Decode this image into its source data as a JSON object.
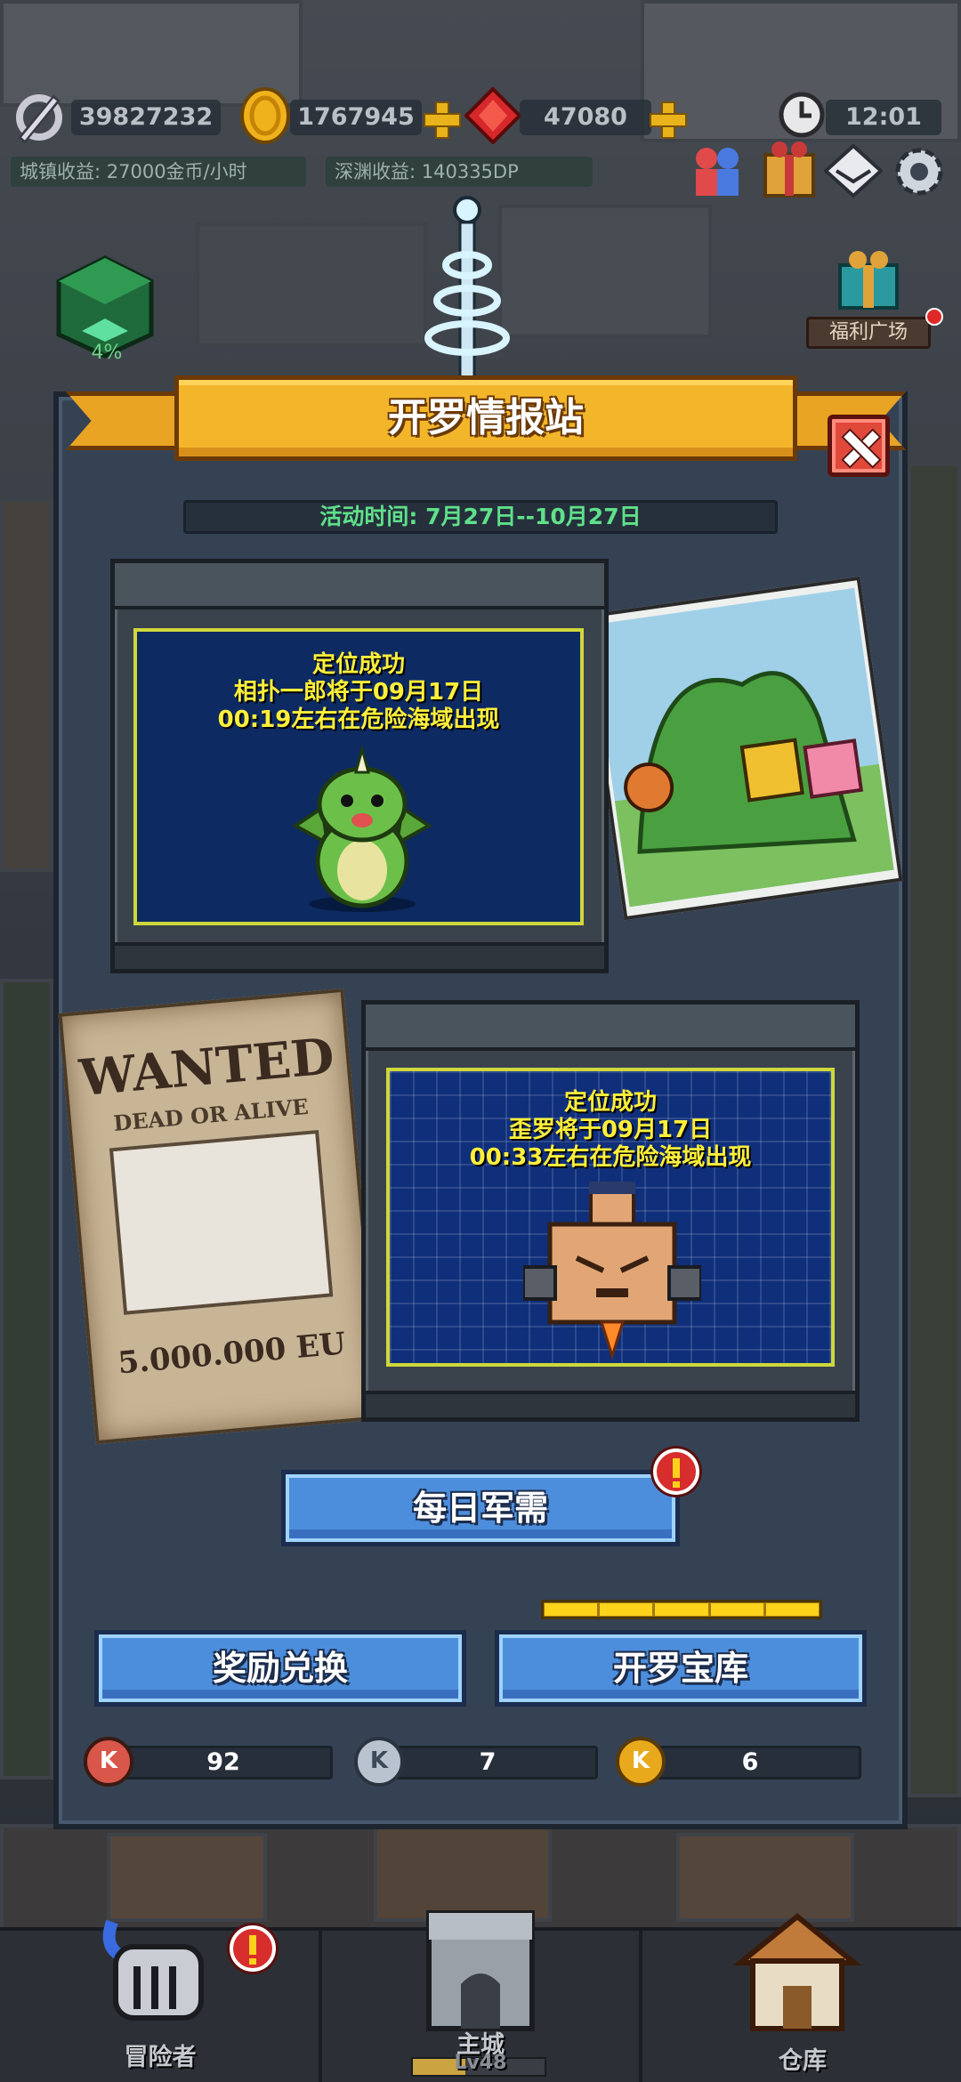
{
  "hud": {
    "power": "39827232",
    "gold": "1767945",
    "gems": "47080",
    "clock": "12:01",
    "town_income": "城镇收益: 27000金币/小时",
    "abyss_income": "深渊收益: 140335DP",
    "build_progress": "4%",
    "welfare_label": "福利广场"
  },
  "panel": {
    "title": "开罗情报站",
    "activity_time": "活动时间: 7月27日--10月27日",
    "monitor1": {
      "line1": "定位成功",
      "line2": "相扑一郎将于09月17日",
      "line3": "00:19左右在危险海域出现"
    },
    "monitor2": {
      "line1": "定位成功",
      "line2": "歪罗将于09月17日",
      "line3": "00:33左右在危险海域出现"
    },
    "poster": {
      "wanted": "WANTED",
      "dead_or_alive": "DEAD OR ALIVE",
      "bounty": "5.000.000 EU"
    },
    "daily_button": "每日军需",
    "exchange_button": "奖励兑换",
    "vault_button": "开罗宝库",
    "vault_progress_segments": 5,
    "currencies": [
      {
        "icon": "red-k-coin-icon",
        "letter": "K",
        "value": "92",
        "color": "#d9564a"
      },
      {
        "icon": "silver-k-coin-icon",
        "letter": "K",
        "value": "7",
        "color": "#b9c3cf"
      },
      {
        "icon": "gold-k-coin-icon",
        "letter": "K",
        "value": "6",
        "color": "#e8a91c"
      }
    ]
  },
  "nav": {
    "adventurer": "冒险者",
    "main_city": "主城",
    "level": "Lv48",
    "warehouse": "仓库"
  },
  "colors": {
    "accent_gold": "#f3b62a",
    "button_blue": "#4d8edc",
    "screen_text": "#ffef3a",
    "time_text": "#5fe08a"
  }
}
